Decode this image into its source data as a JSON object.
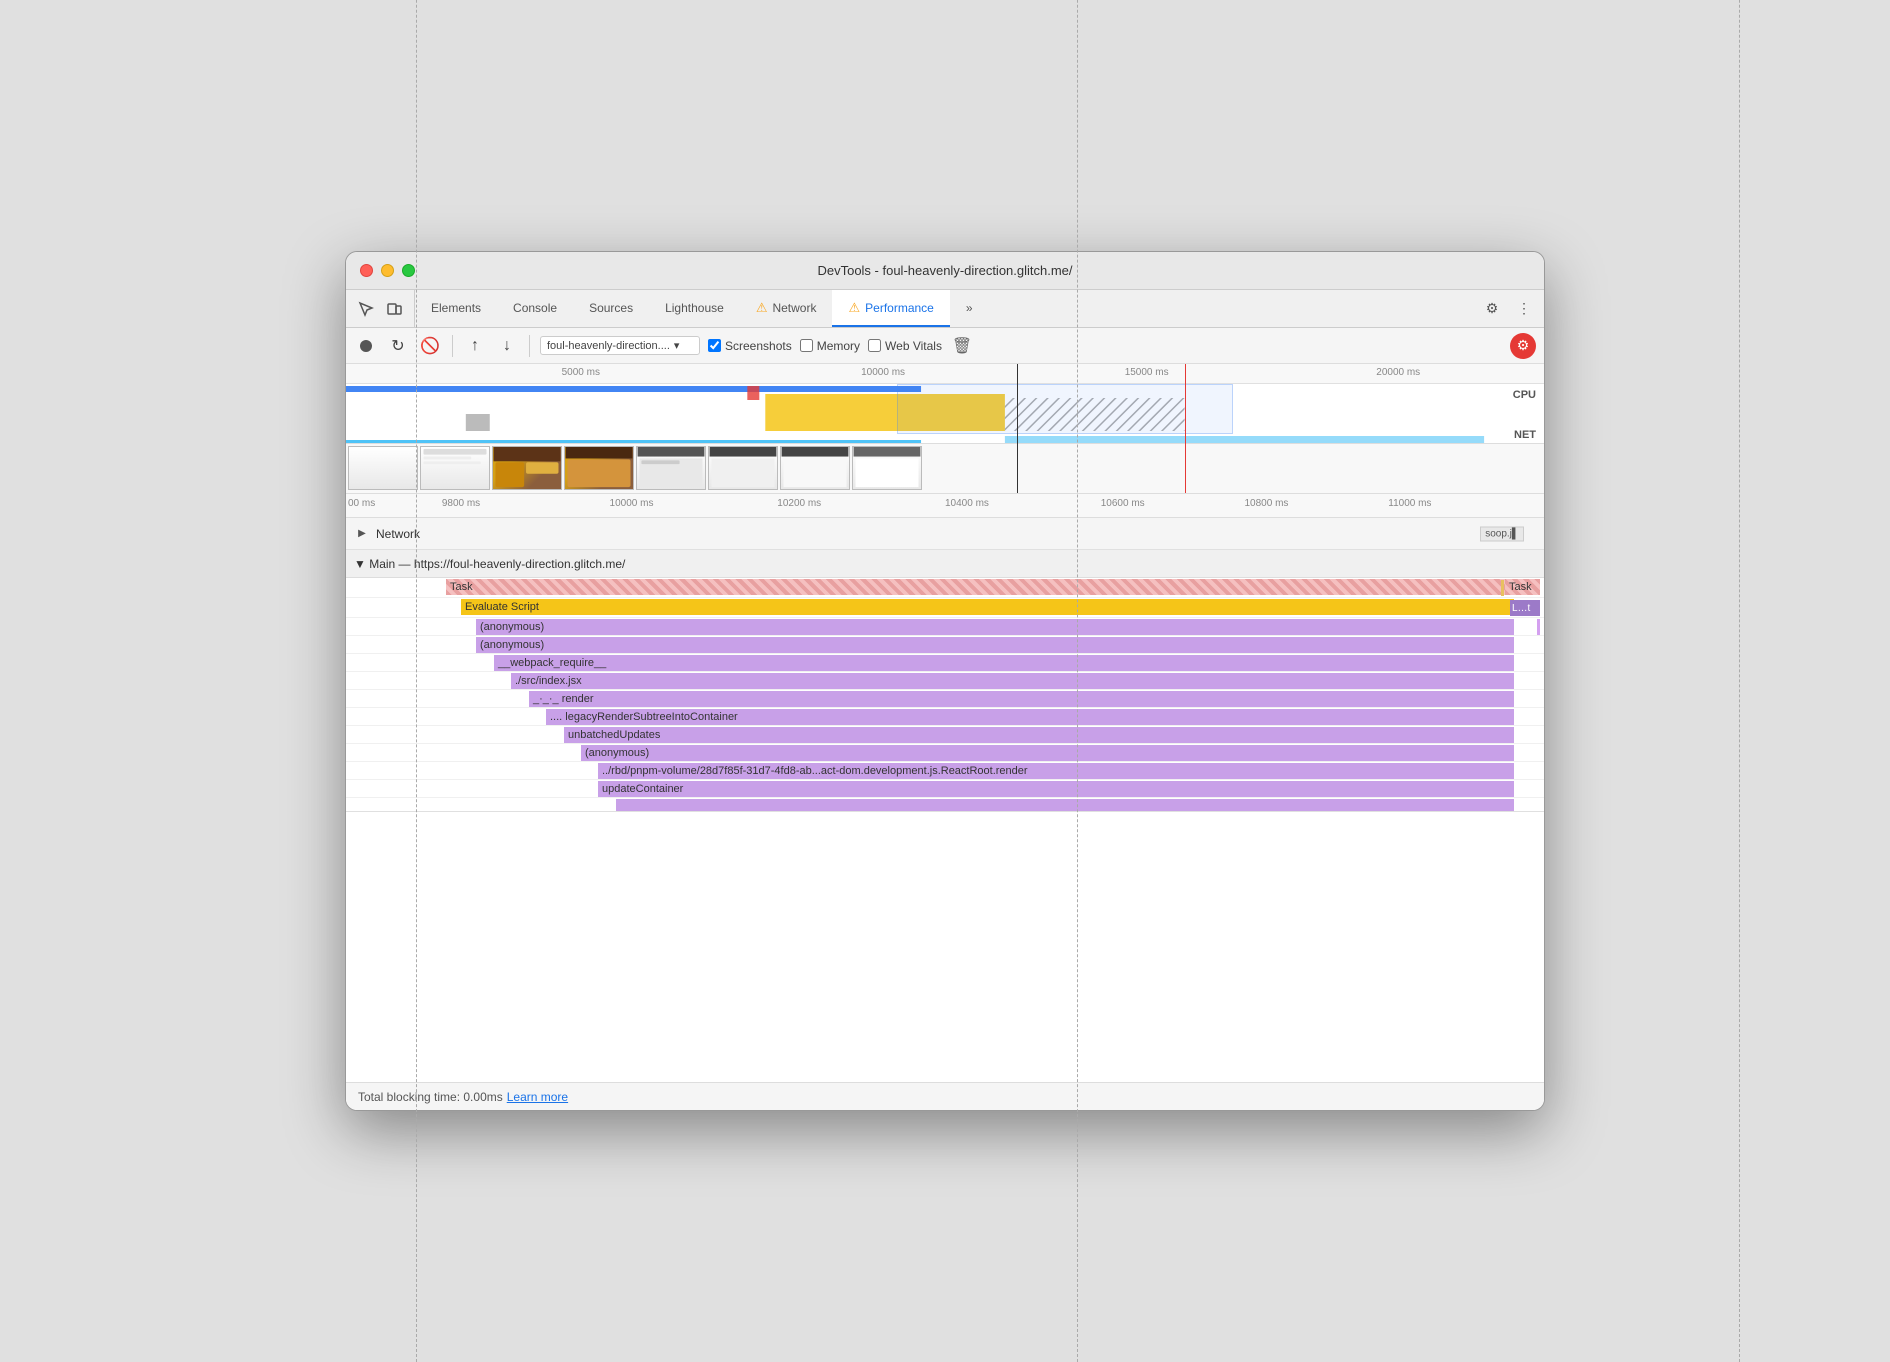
{
  "window": {
    "title": "DevTools - foul-heavenly-direction.glitch.me/"
  },
  "tabs": [
    {
      "id": "elements",
      "label": "Elements",
      "active": false
    },
    {
      "id": "console",
      "label": "Console",
      "active": false
    },
    {
      "id": "sources",
      "label": "Sources",
      "active": false
    },
    {
      "id": "lighthouse",
      "label": "Lighthouse",
      "active": false
    },
    {
      "id": "network",
      "label": "Network",
      "active": false,
      "warn": true
    },
    {
      "id": "performance",
      "label": "Performance",
      "active": true,
      "warn": true
    },
    {
      "id": "more",
      "label": "»",
      "active": false
    }
  ],
  "toolbar": {
    "url_value": "foul-heavenly-direction....",
    "screenshots_checked": true,
    "memory_checked": false,
    "web_vitals_checked": false
  },
  "timeline_ruler": {
    "marks": [
      "5000 ms",
      "10000 ms",
      "15000 ms",
      "20000 ms"
    ]
  },
  "detail_ruler": {
    "marks": [
      "00 ms",
      "9800 ms",
      "10000 ms",
      "10200 ms",
      "10400 ms",
      "10600 ms",
      "10800 ms",
      "11000 ms"
    ]
  },
  "network_row": {
    "label": "Network",
    "badge": "soop.j▌"
  },
  "main_thread": {
    "header": "▼ Main — https://foul-heavenly-direction.glitch.me/",
    "rows": [
      {
        "label": "Task",
        "type": "task",
        "indent": 0
      },
      {
        "label": "Evaluate Script",
        "type": "evaluate",
        "indent": 1
      },
      {
        "label": "(anonymous)",
        "type": "anonymous",
        "indent": 2
      },
      {
        "label": "(anonymous)",
        "type": "anonymous",
        "indent": 2
      },
      {
        "label": "__webpack_require__",
        "type": "anonymous",
        "indent": 3
      },
      {
        "label": "./src/index.jsx",
        "type": "anonymous",
        "indent": 4
      },
      {
        "label": "render",
        "type": "anonymous",
        "indent": 5,
        "prefix": "_·_·_"
      },
      {
        "label": "legacyRenderSubtreeIntoContainer",
        "type": "anonymous",
        "indent": 6,
        "prefix": "...."
      },
      {
        "label": "unbatchedUpdates",
        "type": "anonymous",
        "indent": 7
      },
      {
        "label": "(anonymous)",
        "type": "anonymous",
        "indent": 7
      },
      {
        "label": "../rbd/pnpm-volume/28d7f85f-31d7-4fd8-ab...act-dom.development.js.ReactRoot.render",
        "type": "anonymous",
        "indent": 8
      },
      {
        "label": "updateContainer",
        "type": "anonymous",
        "indent": 8
      }
    ]
  },
  "status_bar": {
    "tbt_label": "Total blocking time: 0.00ms",
    "learn_more": "Learn more"
  },
  "colors": {
    "accent_blue": "#1a73e8",
    "task_red": "#e8a0a0",
    "evaluate_yellow": "#f5c518",
    "anonymous_purple": "#c8a0e8"
  }
}
